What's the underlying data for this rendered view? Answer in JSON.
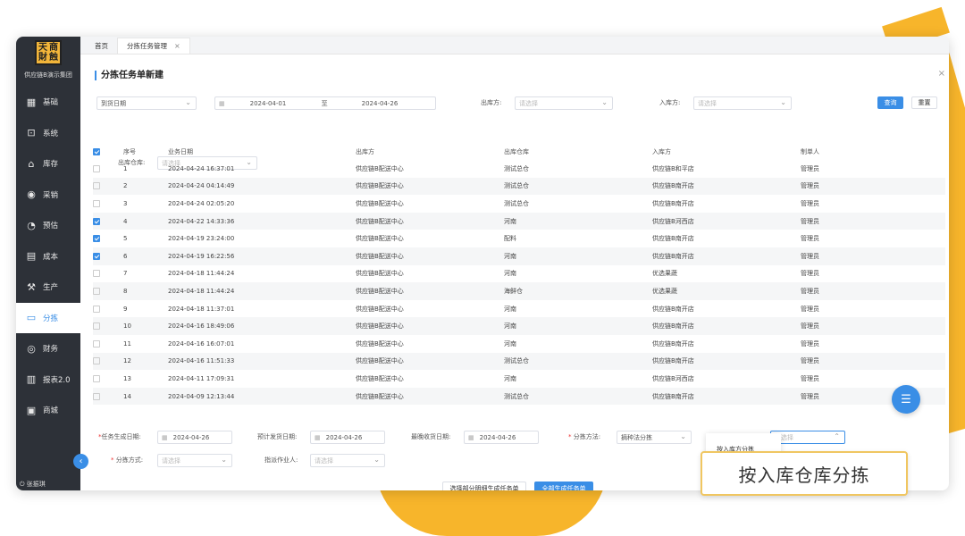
{
  "logo": {
    "chars": [
      "天",
      "商",
      "財",
      "蝕"
    ]
  },
  "company": "供应链B演示集团",
  "nav": [
    {
      "label": "基础",
      "icon": "grid-icon"
    },
    {
      "label": "系统",
      "icon": "system-icon"
    },
    {
      "label": "库存",
      "icon": "warehouse-icon"
    },
    {
      "label": "采销",
      "icon": "exchange-icon"
    },
    {
      "label": "预估",
      "icon": "forecast-icon"
    },
    {
      "label": "成本",
      "icon": "cost-icon"
    },
    {
      "label": "生产",
      "icon": "production-icon"
    },
    {
      "label": "分拣",
      "icon": "sorting-icon"
    },
    {
      "label": "财务",
      "icon": "finance-icon"
    },
    {
      "label": "报表2.0",
      "icon": "report-icon"
    },
    {
      "label": "商城",
      "icon": "mall-icon"
    }
  ],
  "user": "张振琪",
  "tabs": [
    {
      "label": "首页"
    },
    {
      "label": "分拣任务管理"
    }
  ],
  "page_title": "分拣任务单新建",
  "filters": {
    "date_type": "到货日期",
    "date_from": "2024-04-01",
    "date_sep": "至",
    "date_to": "2024-04-26",
    "out_party_label": "出库方:",
    "out_party_placeholder": "请选择",
    "in_party_label": "入库方:",
    "in_party_placeholder": "请选择",
    "query": "查询",
    "reset": "重置",
    "out_wh_label": "出库仓库:",
    "out_wh_placeholder": "请选择"
  },
  "table": {
    "headers": [
      "序号",
      "业务日期",
      "出库方",
      "出库仓库",
      "入库方",
      "制单人"
    ],
    "rows": [
      {
        "checked": false,
        "no": "1",
        "date": "2024-04-24 16:37:01",
        "out": "供应链B配送中心",
        "wh": "测试总仓",
        "in": "供应链B和平店",
        "maker": "管理员"
      },
      {
        "checked": false,
        "no": "2",
        "date": "2024-04-24 04:14:49",
        "out": "供应链B配送中心",
        "wh": "测试总仓",
        "in": "供应链B南开店",
        "maker": "管理员"
      },
      {
        "checked": false,
        "no": "3",
        "date": "2024-04-24 02:05:20",
        "out": "供应链B配送中心",
        "wh": "测试总仓",
        "in": "供应链B南开店",
        "maker": "管理员"
      },
      {
        "checked": true,
        "no": "4",
        "date": "2024-04-22 14:33:36",
        "out": "供应链B配送中心",
        "wh": "河南",
        "in": "供应链B河西店",
        "maker": "管理员"
      },
      {
        "checked": true,
        "no": "5",
        "date": "2024-04-19 23:24:00",
        "out": "供应链B配送中心",
        "wh": "配料",
        "in": "供应链B南开店",
        "maker": "管理员"
      },
      {
        "checked": true,
        "no": "6",
        "date": "2024-04-19 16:22:56",
        "out": "供应链B配送中心",
        "wh": "河南",
        "in": "供应链B南开店",
        "maker": "管理员"
      },
      {
        "checked": false,
        "no": "7",
        "date": "2024-04-18 11:44:24",
        "out": "供应链B配送中心",
        "wh": "河南",
        "in": "优选果蔬",
        "maker": "管理员"
      },
      {
        "checked": false,
        "no": "8",
        "date": "2024-04-18 11:44:24",
        "out": "供应链B配送中心",
        "wh": "海鲜仓",
        "in": "优选果蔬",
        "maker": "管理员"
      },
      {
        "checked": false,
        "no": "9",
        "date": "2024-04-18 11:37:01",
        "out": "供应链B配送中心",
        "wh": "河南",
        "in": "供应链B南开店",
        "maker": "管理员"
      },
      {
        "checked": false,
        "no": "10",
        "date": "2024-04-16 18:49:06",
        "out": "供应链B配送中心",
        "wh": "河南",
        "in": "供应链B南开店",
        "maker": "管理员"
      },
      {
        "checked": false,
        "no": "11",
        "date": "2024-04-16 16:07:01",
        "out": "供应链B配送中心",
        "wh": "河南",
        "in": "供应链B南开店",
        "maker": "管理员"
      },
      {
        "checked": false,
        "no": "12",
        "date": "2024-04-16 11:51:33",
        "out": "供应链B配送中心",
        "wh": "测试总仓",
        "in": "供应链B南开店",
        "maker": "管理员"
      },
      {
        "checked": false,
        "no": "13",
        "date": "2024-04-11 17:09:31",
        "out": "供应链B配送中心",
        "wh": "河南",
        "in": "供应链B河西店",
        "maker": "管理员"
      },
      {
        "checked": false,
        "no": "14",
        "date": "2024-04-09 12:13:44",
        "out": "供应链B配送中心",
        "wh": "测试总仓",
        "in": "供应链B南开店",
        "maker": "管理员"
      }
    ]
  },
  "form": {
    "gen_date_label": "任务生成日期:",
    "gen_date": "2024-04-26",
    "ship_date_label": "预计发货日期:",
    "ship_date": "2024-04-26",
    "recv_date_label": "最晚收货日期:",
    "recv_date": "2024-04-26",
    "method_label": "分拣方法:",
    "method_value": "摘种法分拣",
    "strategy_label": "分拣策略:",
    "strategy_placeholder": "请选择",
    "mode_label": "分拣方式:",
    "mode_placeholder": "请选择",
    "worker_label": "指派作业人:",
    "worker_placeholder": "请选择",
    "dropdown_option": "按入库方分拣",
    "btn_partial": "选择部分明细生成任务单",
    "btn_all": "全部生成任务单"
  },
  "callout": "按入库仓库分拣",
  "colors": {
    "accent": "#3a8ee6",
    "sidebar": "#2d3138",
    "highlight": "#f7b52b"
  }
}
